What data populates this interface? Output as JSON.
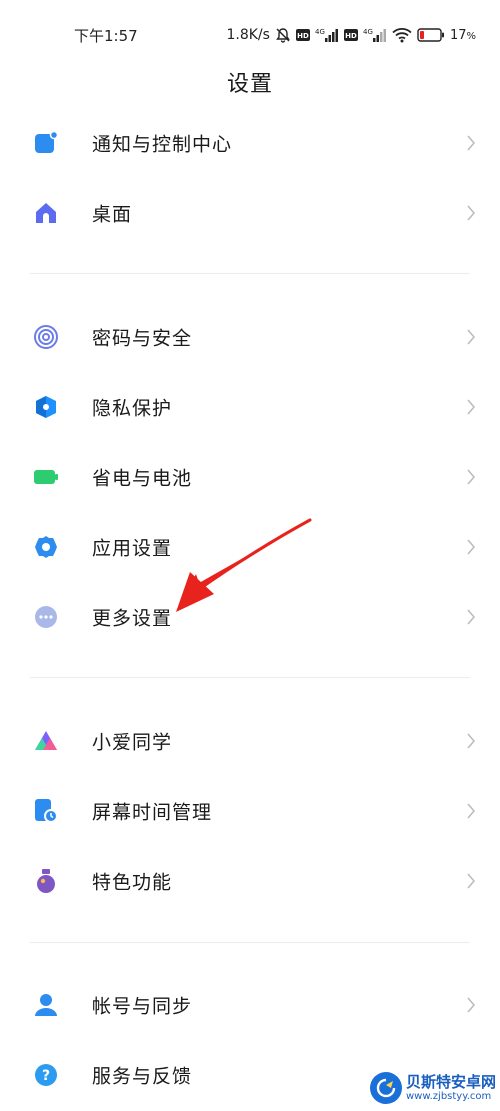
{
  "status_bar": {
    "time": "下午1:57",
    "speed": "1.8K/s",
    "battery_percent": "17",
    "battery_unit": "%",
    "network_1": "4G",
    "network_2": "4G",
    "hd_badge": "HD"
  },
  "header": {
    "title": "设置"
  },
  "groups": [
    {
      "items": [
        {
          "label": "通知与控制中心",
          "icon": "notification-icon",
          "color": "#2d8cf0"
        },
        {
          "label": "桌面",
          "icon": "home-icon",
          "color": "#5b6cf0"
        }
      ]
    },
    {
      "items": [
        {
          "label": "密码与安全",
          "icon": "fingerprint-icon",
          "color": "#6a7ce8"
        },
        {
          "label": "隐私保护",
          "icon": "privacy-shield-icon",
          "color": "#1e90ff"
        },
        {
          "label": "省电与电池",
          "icon": "battery-icon",
          "color": "#2ecc71"
        },
        {
          "label": "应用设置",
          "icon": "gear-icon",
          "color": "#2d8cf0"
        },
        {
          "label": "更多设置",
          "icon": "more-icon",
          "color": "#a9b8e8"
        }
      ]
    },
    {
      "items": [
        {
          "label": "小爱同学",
          "icon": "xiaoai-icon",
          "color": "#7b61ff"
        },
        {
          "label": "屏幕时间管理",
          "icon": "screen-time-icon",
          "color": "#2d8cf0"
        },
        {
          "label": "特色功能",
          "icon": "special-features-icon",
          "color": "#7e57c2"
        }
      ]
    },
    {
      "items": [
        {
          "label": "帐号与同步",
          "icon": "account-icon",
          "color": "#2d8cf0"
        },
        {
          "label": "服务与反馈",
          "icon": "help-icon",
          "color": "#2d9cf0"
        }
      ]
    }
  ],
  "watermark": {
    "title": "贝斯特安卓网",
    "url": "www.zjbstyy.com"
  },
  "annotation": {
    "arrow_color": "#e8231d"
  }
}
